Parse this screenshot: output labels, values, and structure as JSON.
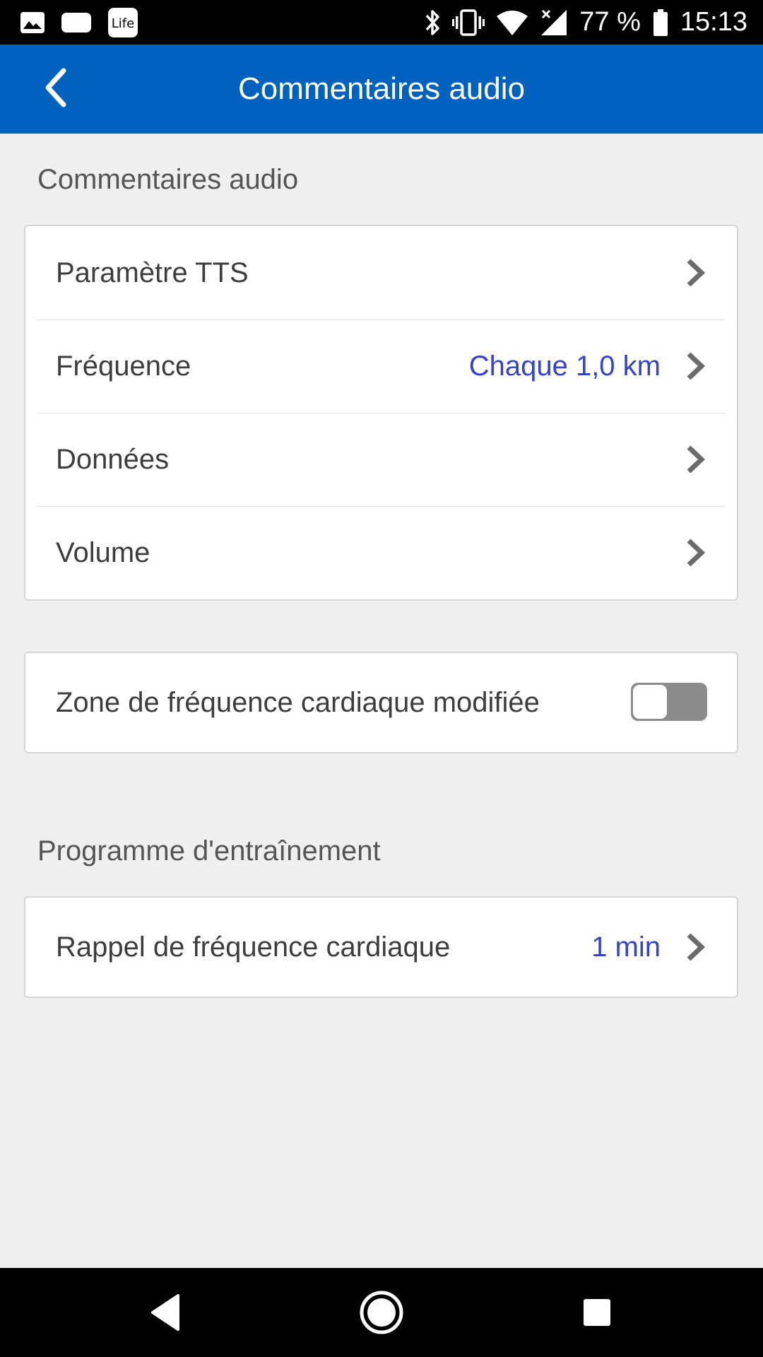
{
  "status_bar": {
    "left_icons": [
      "image-icon",
      "message-icon",
      "lifesum-icon"
    ],
    "lifesum_label": "Life",
    "right_icons": [
      "bluetooth-icon",
      "vibrate-icon",
      "wifi-icon",
      "no-signal-icon",
      "battery-icon"
    ],
    "battery_percent": "77 %",
    "time": "15:13"
  },
  "app_bar": {
    "title": "Commentaires audio",
    "back_icon": "chevron-left-icon",
    "color": "#0062be"
  },
  "section_audio": {
    "header": "Commentaires audio",
    "items": [
      {
        "label": "Paramètre TTS",
        "value": ""
      },
      {
        "label": "Fréquence",
        "value": "Chaque 1,0 km"
      },
      {
        "label": "Données",
        "value": ""
      },
      {
        "label": "Volume",
        "value": ""
      }
    ]
  },
  "section_heart_zone": {
    "label": "Zone de fréquence cardiaque modifiée",
    "toggle_on": false
  },
  "section_training": {
    "header": "Programme d'entraînement",
    "items": [
      {
        "label": "Rappel de fréquence cardiaque",
        "value": "1 min"
      }
    ]
  },
  "nav_bar": {
    "buttons": [
      "back-triangle-icon",
      "home-circle-icon",
      "recents-square-icon"
    ]
  },
  "colors": {
    "accent_value": "#3543c7",
    "background": "#efefef"
  }
}
